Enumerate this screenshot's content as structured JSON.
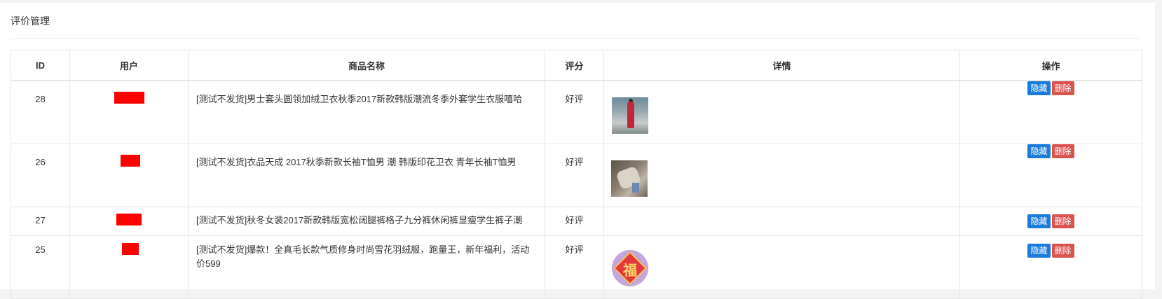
{
  "page": {
    "title": "评价管理"
  },
  "table": {
    "headers": {
      "id": "ID",
      "user": "用户",
      "product": "商品名称",
      "score": "评分",
      "detail": "详情",
      "actions": "操作"
    },
    "rows": [
      {
        "id": "28",
        "product": "[测试不发货]男士套头圆领加绒卫衣秋季2017新款韩版潮流冬季外套学生衣服嘻哈",
        "score": "好评",
        "detail_image": "photo-red-dress",
        "hide_label": "隐藏",
        "delete_label": "删除"
      },
      {
        "id": "26",
        "product": "[测试不发货]衣品天成 2017秋季新款长袖T恤男 潮 韩版印花卫衣 青年长袖T恤男",
        "score": "好评",
        "detail_image": "photo-closeup",
        "hide_label": "隐藏",
        "delete_label": "删除"
      },
      {
        "id": "27",
        "product": "[测试不发货]秋冬女装2017新款韩版宽松阔腿裤格子九分裤休闲裤显瘦学生裤子潮",
        "score": "好评",
        "detail_image": "",
        "hide_label": "隐藏",
        "delete_label": "删除"
      },
      {
        "id": "25",
        "product": "[测试不发货]爆款！全真毛长款气质修身时尚雪花羽绒服，跑量王，新年福利，活动价599",
        "score": "好评",
        "detail_image": "fu-emblem",
        "fu_char": "福",
        "hide_label": "隐藏",
        "delete_label": "删除"
      }
    ]
  },
  "colors": {
    "hide_button": "#1a7bd9",
    "delete_button": "#d9534f",
    "redaction": "#ff0000"
  }
}
